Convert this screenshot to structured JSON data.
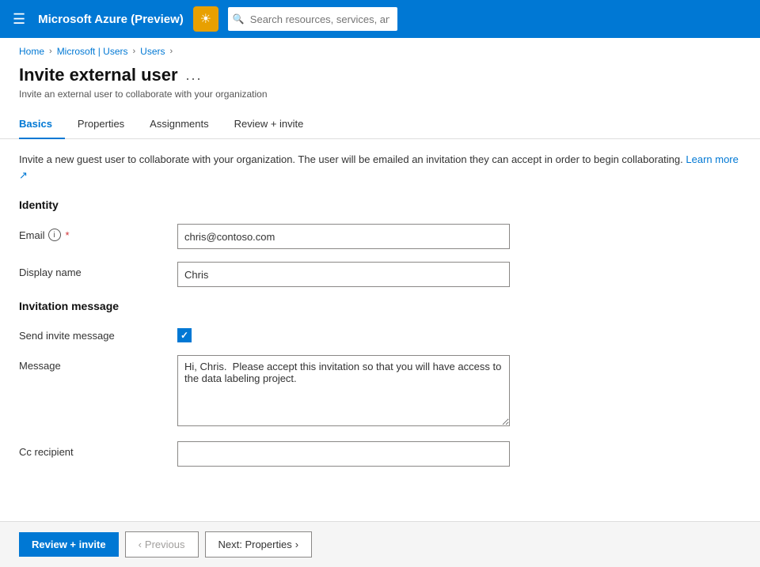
{
  "app": {
    "title": "Microsoft Azure (Preview)",
    "icon": "☀",
    "search_placeholder": "Search resources, services, and docs (G+/)"
  },
  "breadcrumb": {
    "items": [
      "Home",
      "Microsoft | Users",
      "Users"
    ]
  },
  "page": {
    "title": "Invite external user",
    "ellipsis": "...",
    "subtitle": "Invite an external user to collaborate with your organization"
  },
  "tabs": [
    {
      "label": "Basics",
      "active": true
    },
    {
      "label": "Properties",
      "active": false
    },
    {
      "label": "Assignments",
      "active": false
    },
    {
      "label": "Review + invite",
      "active": false
    }
  ],
  "form": {
    "info_text": "Invite a new guest user to collaborate with your organization. The user will be emailed an invitation they can accept in order to begin collaborating.",
    "learn_more": "Learn more",
    "identity_section": "Identity",
    "email_label": "Email",
    "email_value": "chris@contoso.com",
    "display_name_label": "Display name",
    "display_name_value": "Chris",
    "invitation_section": "Invitation message",
    "send_invite_label": "Send invite message",
    "message_label": "Message",
    "message_value": "Hi, Chris.  Please accept this invitation so that you will have access to the data labeling project.",
    "cc_recipient_label": "Cc recipient",
    "cc_recipient_value": ""
  },
  "bottom_bar": {
    "review_invite_label": "Review + invite",
    "previous_label": "Previous",
    "next_label": "Next: Properties",
    "prev_chevron": "‹",
    "next_chevron": "›"
  }
}
